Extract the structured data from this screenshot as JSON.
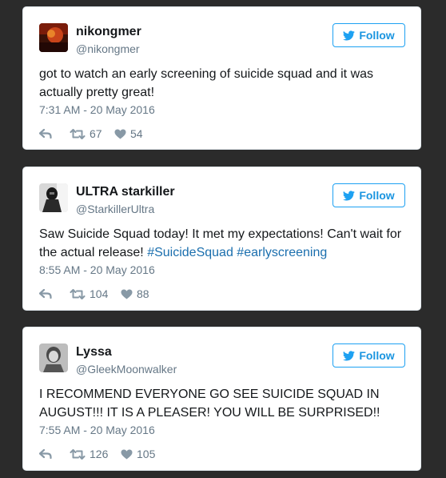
{
  "tweets": [
    {
      "name": "nikongmer",
      "handle": "@nikongmer",
      "follow_label": "Follow",
      "text": "got to watch an early screening of suicide squad and it was actually pretty great!",
      "hashtags": "",
      "timestamp": "7:31 AM - 20 May 2016",
      "retweets": "67",
      "likes": "54"
    },
    {
      "name": "ULTRA starkiller",
      "handle": "@StarkillerUltra",
      "follow_label": "Follow",
      "text": "Saw Suicide Squad today! It met my expectations! Can't wait for the actual release! ",
      "hashtags": "#SuicideSquad #earlyscreening",
      "timestamp": "8:55 AM - 20 May 2016",
      "retweets": "104",
      "likes": "88"
    },
    {
      "name": "Lyssa",
      "handle": "@GleekMoonwalker",
      "follow_label": "Follow",
      "text": "I RECOMMEND EVERYONE GO SEE SUICIDE SQUAD IN AUGUST!!! IT IS A PLEASER! YOU WILL BE SURPRISED!!",
      "hashtags": "",
      "timestamp": "7:55 AM - 20 May 2016",
      "retweets": "126",
      "likes": "105"
    }
  ],
  "colors": {
    "background": "#2b2b2b",
    "card": "#ffffff",
    "accent": "#1da1f2",
    "hashtag": "#1b6fae",
    "muted": "#657786"
  },
  "icons": [
    "twitter-bird-icon",
    "reply-icon",
    "retweet-icon",
    "heart-icon"
  ]
}
